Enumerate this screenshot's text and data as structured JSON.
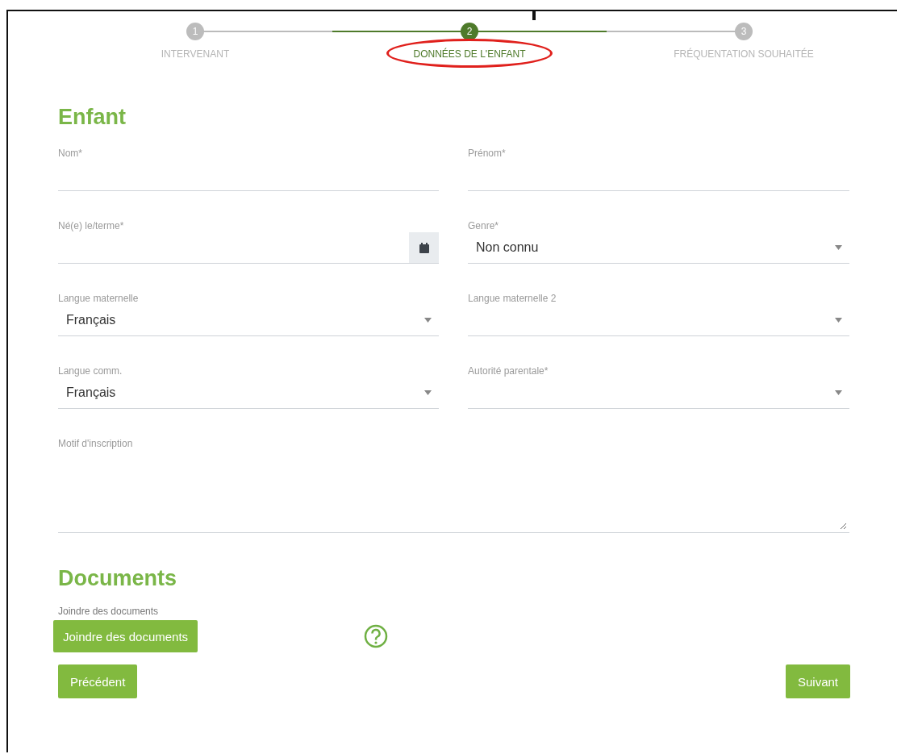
{
  "stepper": {
    "steps": [
      {
        "number": "1",
        "label": "INTERVENANT",
        "selected": false,
        "circled": false
      },
      {
        "number": "2",
        "label": "DONNÉES DE L'ENFANT",
        "selected": true,
        "circled": true
      },
      {
        "number": "3",
        "label": "FRÉQUENTATION SOUHAITÉE",
        "selected": false,
        "circled": false
      }
    ]
  },
  "child_section": {
    "title": "Enfant",
    "fields": [
      {
        "label": "Nom*",
        "kind": "text"
      },
      {
        "label": "Prénom*",
        "kind": "text"
      },
      {
        "label": "Né(e) le/terme*",
        "kind": "date"
      },
      {
        "label": "Genre*",
        "kind": "select",
        "value": "Non connu"
      },
      {
        "label": "Langue maternelle",
        "kind": "select",
        "value": "Français"
      },
      {
        "label": "Langue maternelle 2",
        "kind": "select"
      },
      {
        "label": "Langue comm.",
        "kind": "select",
        "value": "Français"
      },
      {
        "label": "Autorité parentale*",
        "kind": "select"
      },
      {
        "label": "Motif d'inscription",
        "kind": "textarea"
      }
    ]
  },
  "documents_section": {
    "title": "Documents",
    "label": "Joindre des documents",
    "button": "Joindre des documents"
  },
  "navigation": {
    "previous": "Précédent",
    "next": "Suivant"
  }
}
